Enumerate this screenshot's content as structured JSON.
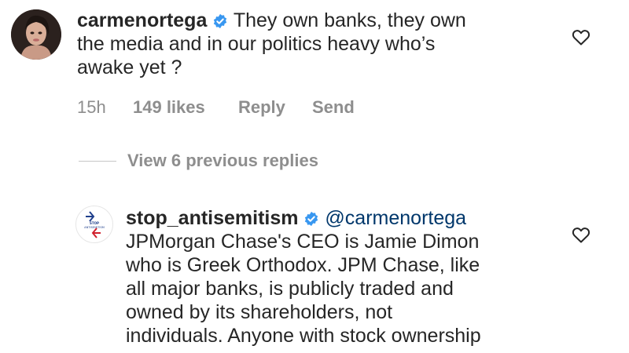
{
  "comment1": {
    "username": "carmenortega",
    "line1": "They own banks, they own",
    "line2": "the media and in our politics heavy who’s",
    "line3": "awake yet ?",
    "time": "15h",
    "likes": "149 likes",
    "reply_label": "Reply",
    "send_label": "Send"
  },
  "replies": {
    "view_label": "View 6 previous replies"
  },
  "comment2": {
    "username": "stop_antisemitism",
    "mention": "@carmenortega",
    "avatar_text_top": "STOP",
    "avatar_text_bottom": "ANTISEMITISM",
    "lines": [
      "JPMorgan Chase's CEO is Jamie Dimon",
      "who is Greek Orthodox. JPM Chase, like",
      "all major banks, is publicly traded and",
      "owned by its shareholders, not",
      "individuals. Anyone with stock ownership"
    ]
  },
  "colors": {
    "text": "#262626",
    "meta": "#8e8e8e",
    "mention": "#00376b",
    "verified": "#3897f0"
  }
}
